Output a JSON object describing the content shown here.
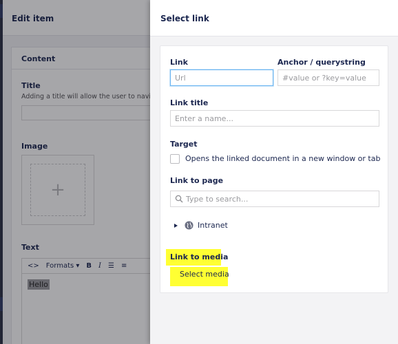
{
  "background": {
    "header_title": "Edit item",
    "content_card_title": "Content",
    "title_field": {
      "label": "Title",
      "description": "Adding a title will allow the user to navigate to"
    },
    "image_field": {
      "label": "Image"
    },
    "text_field": {
      "label": "Text",
      "toolbar": {
        "formats_label": "Formats"
      },
      "content": "Hello"
    }
  },
  "dialog": {
    "title": "Select link",
    "link": {
      "label": "Link",
      "placeholder": "Url"
    },
    "anchor": {
      "label": "Anchor / querystring",
      "placeholder": "#value or ?key=value"
    },
    "link_title": {
      "label": "Link title",
      "placeholder": "Enter a name..."
    },
    "target": {
      "label": "Target",
      "option_text": "Opens the linked document in a new window or tab"
    },
    "link_to_page": {
      "label": "Link to page",
      "search_placeholder": "Type to search...",
      "tree": [
        {
          "label": "Intranet",
          "icon": "globe-icon"
        }
      ]
    },
    "link_to_media": {
      "label": "Link to media",
      "button_label": "Select media"
    }
  },
  "colors": {
    "highlight": "#ffff33",
    "focus_border": "#6ab4f0",
    "text_primary": "#1b264f"
  }
}
